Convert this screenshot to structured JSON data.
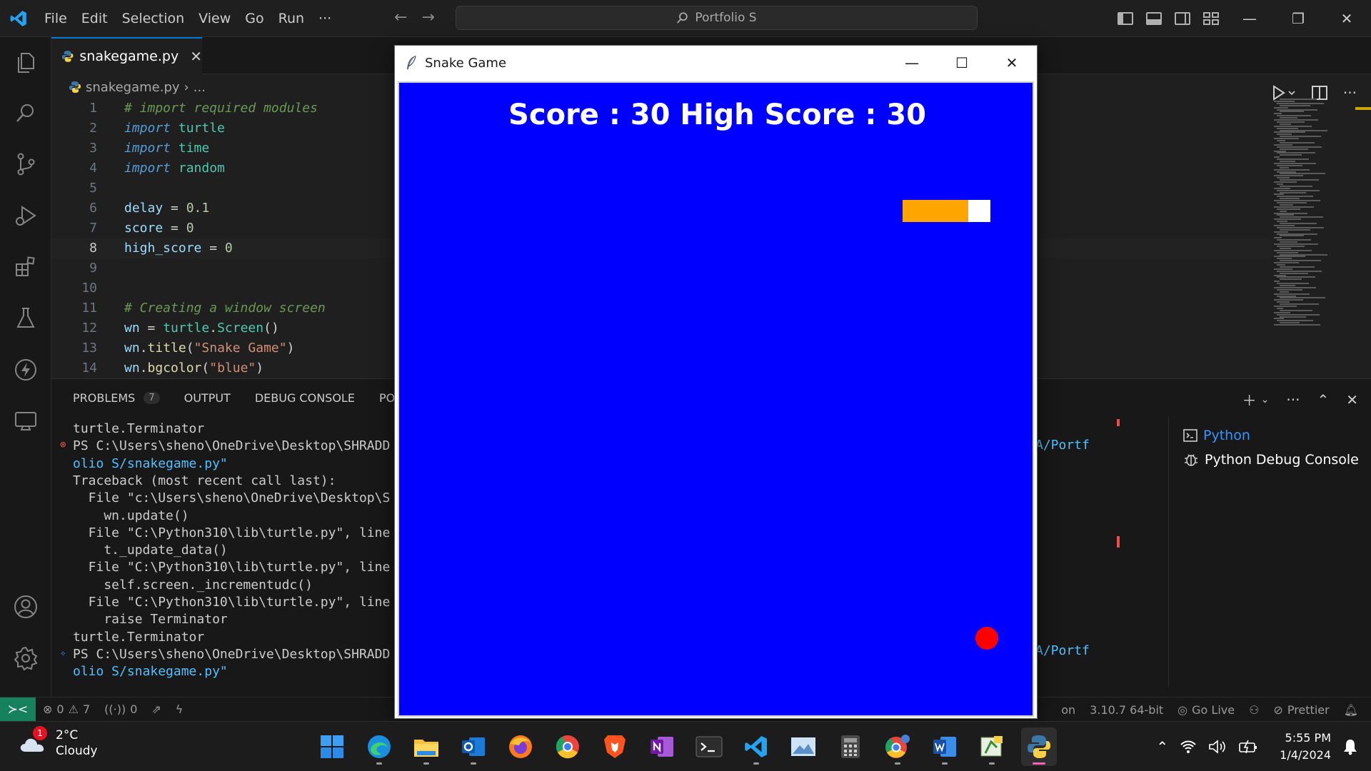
{
  "titlebar": {
    "menu": [
      "File",
      "Edit",
      "Selection",
      "View",
      "Go",
      "Run",
      "···"
    ],
    "command_center": "Portfolio S"
  },
  "editor": {
    "tab_label": "snakegame.py",
    "breadcrumb_file": "snakegame.py",
    "breadcrumb_more": "...",
    "lines": [
      {
        "n": "1",
        "tokens": [
          {
            "t": "# import required modules",
            "c": "t-comment"
          }
        ]
      },
      {
        "n": "2",
        "tokens": [
          {
            "t": "import",
            "c": "t-kw"
          },
          {
            "t": " "
          },
          {
            "t": "turtle",
            "c": "t-mod"
          }
        ]
      },
      {
        "n": "3",
        "tokens": [
          {
            "t": "import",
            "c": "t-kw"
          },
          {
            "t": " "
          },
          {
            "t": "time",
            "c": "t-mod"
          }
        ]
      },
      {
        "n": "4",
        "tokens": [
          {
            "t": "import",
            "c": "t-kw"
          },
          {
            "t": " "
          },
          {
            "t": "random",
            "c": "t-mod"
          }
        ]
      },
      {
        "n": "5",
        "tokens": []
      },
      {
        "n": "6",
        "tokens": [
          {
            "t": "delay",
            "c": "t-var"
          },
          {
            "t": " = ",
            "c": "t-op"
          },
          {
            "t": "0.1",
            "c": "t-num"
          }
        ]
      },
      {
        "n": "7",
        "tokens": [
          {
            "t": "score",
            "c": "t-var"
          },
          {
            "t": " = ",
            "c": "t-op"
          },
          {
            "t": "0",
            "c": "t-num"
          }
        ]
      },
      {
        "n": "8",
        "tokens": [
          {
            "t": "high_score",
            "c": "t-var"
          },
          {
            "t": " = ",
            "c": "t-op"
          },
          {
            "t": "0",
            "c": "t-num"
          }
        ],
        "active": true
      },
      {
        "n": "9",
        "tokens": []
      },
      {
        "n": "10",
        "tokens": []
      },
      {
        "n": "11",
        "tokens": [
          {
            "t": "# Creating a window screen",
            "c": "t-comment"
          }
        ]
      },
      {
        "n": "12",
        "tokens": [
          {
            "t": "wn",
            "c": "t-var"
          },
          {
            "t": " = ",
            "c": "t-op"
          },
          {
            "t": "turtle",
            "c": "t-mod"
          },
          {
            "t": ".",
            "c": "t-op"
          },
          {
            "t": "Screen",
            "c": "t-mod"
          },
          {
            "t": "()",
            "c": "t-op"
          }
        ]
      },
      {
        "n": "13",
        "tokens": [
          {
            "t": "wn",
            "c": "t-var"
          },
          {
            "t": ".",
            "c": "t-op"
          },
          {
            "t": "title",
            "c": "t-fn"
          },
          {
            "t": "(",
            "c": "t-op"
          },
          {
            "t": "\"Snake Game\"",
            "c": "t-str"
          },
          {
            "t": ")",
            "c": "t-op"
          }
        ]
      },
      {
        "n": "14",
        "tokens": [
          {
            "t": "wn",
            "c": "t-var"
          },
          {
            "t": ".",
            "c": "t-op"
          },
          {
            "t": "bgcolor",
            "c": "t-fn"
          },
          {
            "t": "(",
            "c": "t-op"
          },
          {
            "t": "\"blue\"",
            "c": "t-str"
          },
          {
            "t": ")",
            "c": "t-op"
          }
        ]
      }
    ]
  },
  "panel": {
    "tabs": [
      {
        "label": "PROBLEMS",
        "badge": "7"
      },
      {
        "label": "OUTPUT"
      },
      {
        "label": "DEBUG CONSOLE"
      },
      {
        "label": "POR"
      }
    ],
    "terminal_lines": [
      {
        "text": "turtle.Terminator"
      },
      {
        "text": "PS C:\\Users\\sheno\\OneDrive\\Desktop\\SHRADD",
        "mark": "error"
      },
      {
        "text": "olio S/snakegame.py\"",
        "cls": "t-path"
      },
      {
        "text": "Traceback (most recent call last):"
      },
      {
        "text": "  File \"c:\\Users\\sheno\\OneDrive\\Desktop\\S"
      },
      {
        "text": "    wn.update()"
      },
      {
        "text": "  File \"C:\\Python310\\lib\\turtle.py\", line"
      },
      {
        "text": "    t._update_data()"
      },
      {
        "text": "  File \"C:\\Python310\\lib\\turtle.py\", line"
      },
      {
        "text": "    self.screen._incrementudc()"
      },
      {
        "text": "  File \"C:\\Python310\\lib\\turtle.py\", line"
      },
      {
        "text": "    raise Terminator"
      },
      {
        "text": "turtle.Terminator"
      },
      {
        "text": "PS C:\\Users\\sheno\\OneDrive\\Desktop\\SHRADD",
        "mark": "sparkle"
      },
      {
        "text": "olio S/snakegame.py\"",
        "cls": "t-path"
      }
    ],
    "terminal_right_fragments": [
      "A/Portf",
      "A/Portf"
    ],
    "terminals": [
      "Python",
      "Python Debug Console"
    ]
  },
  "statusbar": {
    "errors": "0",
    "warnings": "7",
    "ports": "0",
    "lang_fragment": "on",
    "python_version": "3.10.7 64-bit",
    "go_live": "Go Live",
    "prettier": "Prettier"
  },
  "snake_window": {
    "title": "Snake Game",
    "score_text": "Score : 30 High Score : 30"
  },
  "taskbar": {
    "weather_temp": "2°C",
    "weather_desc": "Cloudy",
    "weather_badge": "1",
    "time": "5:55 PM",
    "date": "1/4/2024"
  }
}
